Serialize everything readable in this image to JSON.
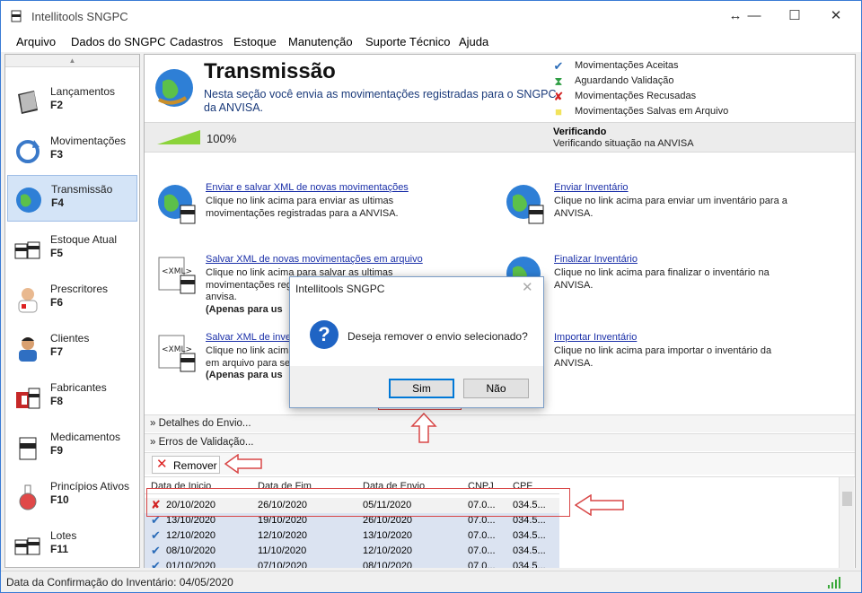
{
  "window": {
    "title": "Intellitools SNGPC",
    "controls": {
      "resize": "↔",
      "minimize": "—",
      "maximize": "☐",
      "close": "✕"
    }
  },
  "menu": [
    "Arquivo",
    "Dados do SNGPC",
    "Cadastros",
    "Estoque",
    "Manutenção",
    "Suporte Técnico",
    "Ajuda"
  ],
  "sidebar": {
    "items": [
      {
        "label": "Lançamentos",
        "key": "F2",
        "icon": "book-icon"
      },
      {
        "label": "Movimentações",
        "key": "F3",
        "icon": "refresh-icon"
      },
      {
        "label": "Transmissão",
        "key": "F4",
        "icon": "globe-icon",
        "active": true
      },
      {
        "label": "Estoque Atual",
        "key": "F5",
        "icon": "boxes-icon"
      },
      {
        "label": "Prescritores",
        "key": "F6",
        "icon": "doctor-icon"
      },
      {
        "label": "Clientes",
        "key": "F7",
        "icon": "person-icon"
      },
      {
        "label": "Fabricantes",
        "key": "F8",
        "icon": "factory-icon"
      },
      {
        "label": "Medicamentos",
        "key": "F9",
        "icon": "pill-box-icon"
      },
      {
        "label": "Princípios Ativos",
        "key": "F10",
        "icon": "flask-icon"
      },
      {
        "label": "Lotes",
        "key": "F11",
        "icon": "boxes-icon"
      }
    ]
  },
  "header": {
    "title": "Transmissão",
    "description": "Nesta seção você envia as movimentações registradas para o SNGPC da ANVISA."
  },
  "legend": [
    {
      "icon": "checkmark-icon",
      "glyph": "✔",
      "color": "#2b6cb8",
      "text": "Movimentações Aceitas"
    },
    {
      "icon": "hourglass-icon",
      "glyph": "⧗",
      "color": "#2f9e44",
      "text": "Aguardando Validação"
    },
    {
      "icon": "cross-icon",
      "glyph": "✘",
      "color": "#d22222",
      "text": "Movimentações Recusadas"
    },
    {
      "icon": "note-icon",
      "glyph": "■",
      "color": "#f2e35c",
      "text": "Movimentações Salvas em Arquivo"
    }
  ],
  "progress": {
    "percent_label": "100%",
    "value": 1.0,
    "status_title": "Verificando",
    "status_sub": "Verificando situação na ANVISA"
  },
  "actions": {
    "send_new": {
      "link": "Enviar e salvar XML de novas movimentações",
      "desc": "Clique no link acima para enviar as ultimas movimentações registradas para a ANVISA."
    },
    "save_new": {
      "link": "Salvar XML de novas movimentações em arquivo",
      "desc": "Clique no link acima para salvar as ultimas movimentações registradas em arquivo no site da anvisa.",
      "note": "(Apenas para us"
    },
    "save_inv": {
      "link": "Salvar XML de inven",
      "desc": "Clique no link acima em arquivo para se",
      "note": "(Apenas para us"
    },
    "send_inv": {
      "link": "Enviar Inventário",
      "desc": "Clique no link acima para enviar um inventário para a ANVISA."
    },
    "finish_inv": {
      "link": "Finalizar Inventário",
      "desc": "Clique no link acima para finalizar o inventário na ANVISA."
    },
    "import_inv": {
      "link": "Importar Inventário",
      "desc": "Clique no link acima para importar o inventário da ANVISA."
    }
  },
  "sections": {
    "details": "Detalhes do Envio...",
    "errors": "Erros de Validação..."
  },
  "toolbar": {
    "remove_label": "Remover"
  },
  "grid": {
    "columns": [
      "Data de Inicio",
      "Data de Fim",
      "Data de Envio",
      "CNPJ",
      "CPF"
    ],
    "rows": [
      {
        "status": "cross-icon",
        "glyph": "✘",
        "color": "#d22222",
        "cells": [
          "20/10/2020",
          "26/10/2020",
          "05/11/2020",
          "07.0...",
          "034.5..."
        ]
      },
      {
        "status": "checkmark-icon",
        "glyph": "✔",
        "color": "#2b6cb8",
        "cells": [
          "13/10/2020",
          "19/10/2020",
          "26/10/2020",
          "07.0...",
          "034.5..."
        ]
      },
      {
        "status": "checkmark-icon",
        "glyph": "✔",
        "color": "#2b6cb8",
        "cells": [
          "12/10/2020",
          "12/10/2020",
          "13/10/2020",
          "07.0...",
          "034.5..."
        ]
      },
      {
        "status": "checkmark-icon",
        "glyph": "✔",
        "color": "#2b6cb8",
        "cells": [
          "08/10/2020",
          "11/10/2020",
          "12/10/2020",
          "07.0...",
          "034.5..."
        ]
      },
      {
        "status": "checkmark-icon",
        "glyph": "✔",
        "color": "#2b6cb8",
        "cells": [
          "01/10/2020",
          "07/10/2020",
          "08/10/2020",
          "07.0...",
          "034.5..."
        ]
      }
    ]
  },
  "statusbar": {
    "text": "Data da Confirmação do Inventário: 04/05/2020"
  },
  "dialog": {
    "title": "Intellitools SNGPC",
    "message": "Deseja remover o envio selecionado?",
    "yes": "Sim",
    "no": "Não",
    "icon": "question-icon",
    "glyph": "?"
  },
  "colors": {
    "accent": "#0078d7",
    "link": "#1a2fa8",
    "annotation": "#d84646",
    "progress": "#8bd33a"
  }
}
